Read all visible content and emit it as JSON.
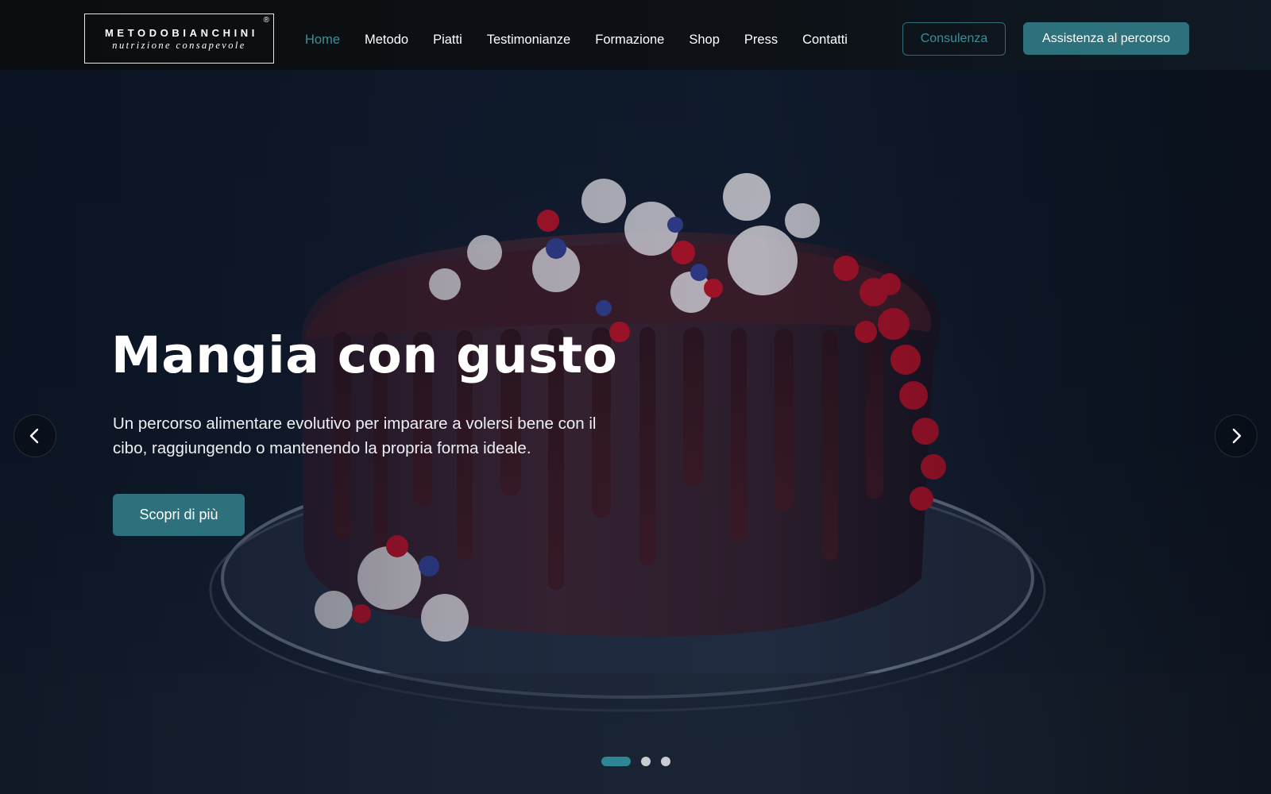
{
  "brand": {
    "name": "METODOBIANCHINI",
    "registered": "®",
    "tagline": "nutrizione consapevole"
  },
  "nav": {
    "items": [
      {
        "label": "Home",
        "active": true
      },
      {
        "label": "Metodo",
        "active": false
      },
      {
        "label": "Piatti",
        "active": false
      },
      {
        "label": "Testimonianze",
        "active": false
      },
      {
        "label": "Formazione",
        "active": false
      },
      {
        "label": "Shop",
        "active": false
      },
      {
        "label": "Press",
        "active": false
      },
      {
        "label": "Contatti",
        "active": false
      }
    ],
    "consult_label": "Consulenza",
    "assist_label": "Assistenza al percorso"
  },
  "hero": {
    "title": "Mangia con gusto",
    "subtitle": "Un percorso alimentare evolutivo per imparare a volersi bene con il cibo, raggiungendo o mantenendo la propria forma ideale.",
    "cta_label": "Scopri di più",
    "background_image": "chocolate-drip-cake-with-cream-and-berries",
    "prev_icon": "chevron-left-icon",
    "next_icon": "chevron-right-icon",
    "slides_total": 3,
    "slide_active": 1
  },
  "colors": {
    "accent": "#2c717c",
    "accent_text": "#3d8e9a",
    "header_bg": "#0b0d0f"
  }
}
